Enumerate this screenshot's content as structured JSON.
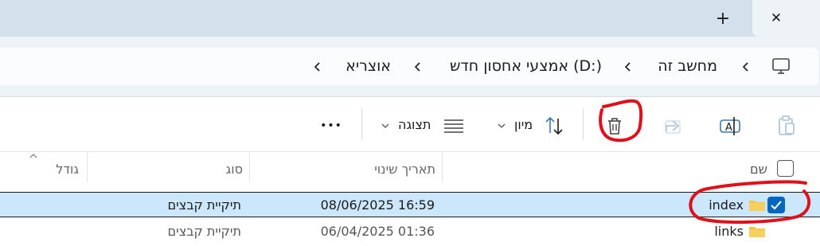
{
  "tabs": {
    "new_tab_label": "+",
    "close_label": "✕"
  },
  "breadcrumb": {
    "items": [
      "מחשב זה",
      "אמצעי אחסון חדש (D:)",
      "אוצריא"
    ]
  },
  "toolbar": {
    "sort_label": "מיון",
    "view_label": "תצוגה",
    "more_label": "•••"
  },
  "columns": {
    "name": "שם",
    "date_modified": "תאריך שינוי",
    "type": "סוג",
    "size": "גודל"
  },
  "files": [
    {
      "name": "index",
      "date": "08/06/2025 16:59",
      "type": "תיקיית קבצים",
      "selected": true
    },
    {
      "name": "links",
      "date": "06/04/2025 01:36",
      "type": "תיקיית קבצים",
      "selected": false
    }
  ],
  "colors": {
    "tabstrip": "#d4e0ec",
    "selection": "#cce6fb",
    "accent": "#0067c0",
    "annotation": "#e0101b",
    "folder": "#f5c24a"
  }
}
